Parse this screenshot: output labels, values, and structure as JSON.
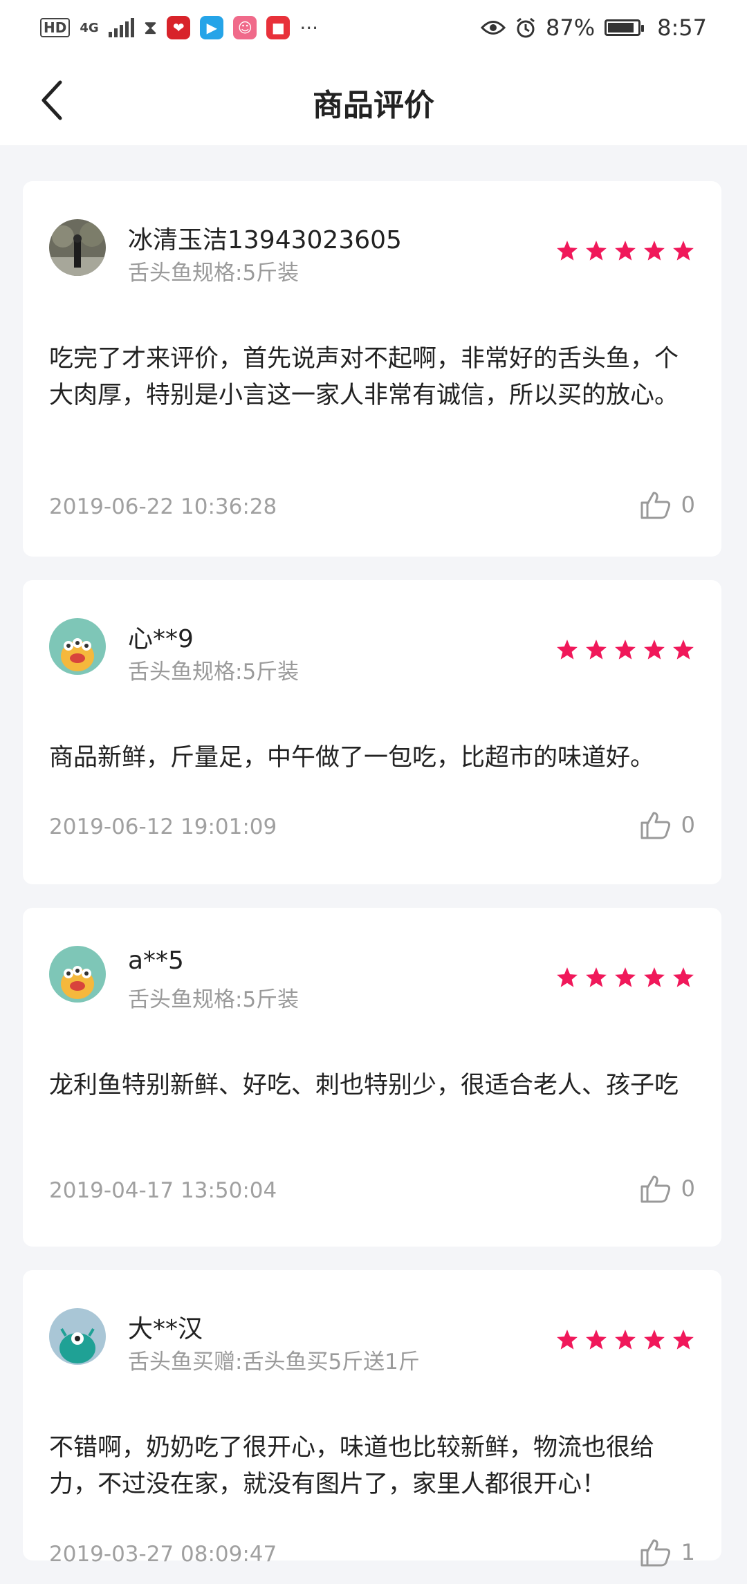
{
  "status_bar": {
    "hd_label": "HD",
    "network_label": "4G",
    "battery_percent": "87%",
    "battery_level": 0.87,
    "time": "8:57",
    "icons": [
      "hd-icon",
      "signal-icon",
      "hourglass-icon",
      "app-heart-icon",
      "app-delivery-icon",
      "app-pink-icon",
      "app-red-icon",
      "more-dots-icon",
      "eye-icon",
      "alarm-icon",
      "battery-icon"
    ]
  },
  "header": {
    "title": "商品评价",
    "back_icon": "back-arrow-icon"
  },
  "colors": {
    "star": "#f0185a",
    "page_bg": "#f4f5f8",
    "card_bg": "#ffffff",
    "secondary_text": "#9a9a9a"
  },
  "reviews": [
    {
      "user": "冰清玉洁13943023605",
      "spec": "舌头鱼规格:5斤装",
      "rating": 5,
      "text": "吃完了才来评价，首先说声对不起啊，非常好的舌头鱼，个大肉厚，特别是小言这一家人非常有诚信，所以买的放心。",
      "date": "2019-06-22   10:36:28",
      "likes": "0",
      "avatar": "photo"
    },
    {
      "user": "心**9",
      "spec": "舌头鱼规格:5斤装",
      "rating": 5,
      "text": "商品新鲜，斤量足，中午做了一包吃，比超市的味道好。",
      "date": "2019-06-12   19:01:09",
      "likes": "0",
      "avatar": "monster-orange"
    },
    {
      "user": "a**5",
      "spec": "舌头鱼规格:5斤装",
      "rating": 5,
      "text": "龙利鱼特别新鲜、好吃、刺也特别少，很适合老人、孩子吃",
      "date": "2019-04-17   13:50:04",
      "likes": "0",
      "avatar": "monster-orange"
    },
    {
      "user": "大**汉",
      "spec": "舌头鱼买赠:舌头鱼买5斤送1斤",
      "rating": 5,
      "text": "不错啊，奶奶吃了很开心，味道也比较新鲜，物流也很给力，不过没在家，就没有图片了，家里人都很开心！",
      "date": "2019-03-27   08:09:47",
      "likes": "1",
      "avatar": "monster-teal"
    }
  ]
}
